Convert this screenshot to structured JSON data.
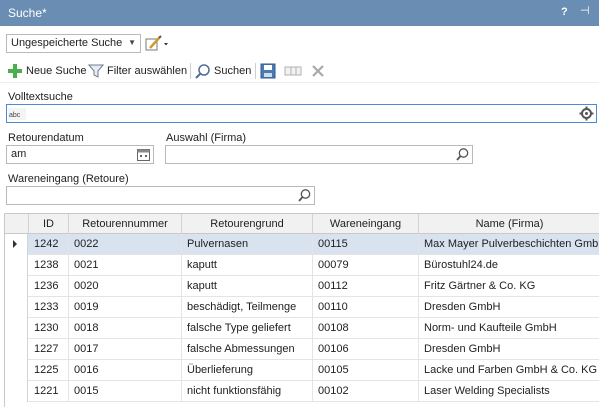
{
  "window": {
    "title": "Suche*",
    "help": "?",
    "pin": "⊣"
  },
  "toolbar": {
    "saved_search_value": "Ungespeicherte Suche",
    "new_search_label": "Neue Suche",
    "filter_label": "Filter auswählen",
    "search_label": "Suchen"
  },
  "fields": {
    "volltext_label": "Volltextsuche",
    "volltext_prefix": "abc",
    "volltext_value": "",
    "retourendatum_label": "Retourendatum",
    "retourendatum_value": "am",
    "auswahl_label": "Auswahl (Firma)",
    "auswahl_value": "",
    "wareneingang_label": "Wareneingang (Retoure)",
    "wareneingang_value": ""
  },
  "table": {
    "columns": [
      "ID",
      "Retourennummer",
      "Retourengrund",
      "Wareneingang",
      "Name (Firma)"
    ],
    "rows": [
      [
        "1242",
        "0022",
        "Pulvernasen",
        "00115",
        "Max Mayer Pulverbeschichten GmbH"
      ],
      [
        "1238",
        "0021",
        "kaputt",
        "00079",
        "Bürostuhl24.de"
      ],
      [
        "1236",
        "0020",
        "kaputt",
        "00112",
        "Fritz Gärtner & Co. KG"
      ],
      [
        "1233",
        "0019",
        "beschädigt, Teilmenge",
        "00110",
        "Dresden GmbH"
      ],
      [
        "1230",
        "0018",
        "falsche Type geliefert",
        "00108",
        "Norm- und Kaufteile GmbH"
      ],
      [
        "1227",
        "0017",
        "falsche Abmessungen",
        "00106",
        "Dresden GmbH"
      ],
      [
        "1225",
        "0016",
        "Überlieferung",
        "00105",
        "Lacke und Farben GmbH & Co. KG"
      ],
      [
        "1221",
        "0015",
        "nicht funktionsfähig",
        "00102",
        "Laser Welding Specialists"
      ]
    ]
  },
  "colors": {
    "titlebar": "#6a8db3",
    "selected_row": "#d9e3f0",
    "focus_border": "#4d8ad6"
  }
}
